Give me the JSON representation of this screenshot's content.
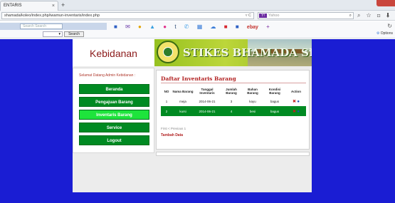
{
  "browser": {
    "tab_title": "ENTARIS",
    "tab_close": "×",
    "new_tab": "+",
    "url": "shamada/koleo/index.php/iwamun-inventaris/index.php",
    "url_controls": "▿ C",
    "search_placeholder": "Yahoo",
    "search_engine_logo": "Y!",
    "nav_icons": "⌕ ☆ ⊡ ⬇ ⌂ ≡"
  },
  "toolbar": {
    "search_placeholder": "Search Search",
    "search_button": "Search",
    "options_label": "Options",
    "icons": [
      "search-icon",
      "mail-icon",
      "shopping-icon",
      "image-icon",
      "flickr-icon",
      "tumblr-icon",
      "chat-icon",
      "calendar-icon",
      "weather-icon",
      "bookmark-icon",
      "flipboard-icon",
      "ebay-icon",
      "add-icon"
    ],
    "ebay_label": "ebay",
    "plus": "+"
  },
  "site": {
    "brand": "Kebidanan",
    "banner_title": "STIKES BHAMADA SLAWI",
    "colors": {
      "page_bg": "#1a1dd3",
      "menu_green": "#008a22",
      "menu_active": "#1ee43c",
      "title_red": "#b22222"
    }
  },
  "sidebar": {
    "welcome": "Selamat Datang Admin Kebidanan :",
    "items": [
      {
        "label": "Beranda"
      },
      {
        "label": "Pengajuan Barang"
      },
      {
        "label": "Inventaris Barang"
      },
      {
        "label": "Service"
      },
      {
        "label": "Logout"
      }
    ]
  },
  "content": {
    "title": "Daftar Inventaris Barang",
    "columns": [
      "NO",
      "Nama Barang",
      "Tanggal Inventaris",
      "Jumlah Barang",
      "Bahan Barang",
      "Kondisi Barang",
      "Action"
    ],
    "rows": [
      [
        "1",
        "meja",
        "2014-06-21",
        "3",
        "kayu",
        "bagus"
      ],
      [
        "2",
        "kursi",
        "2014-06-21",
        "4",
        "besi",
        "bagus"
      ]
    ],
    "pager": "First < Previous 1",
    "add_link": "Tambah Data"
  }
}
